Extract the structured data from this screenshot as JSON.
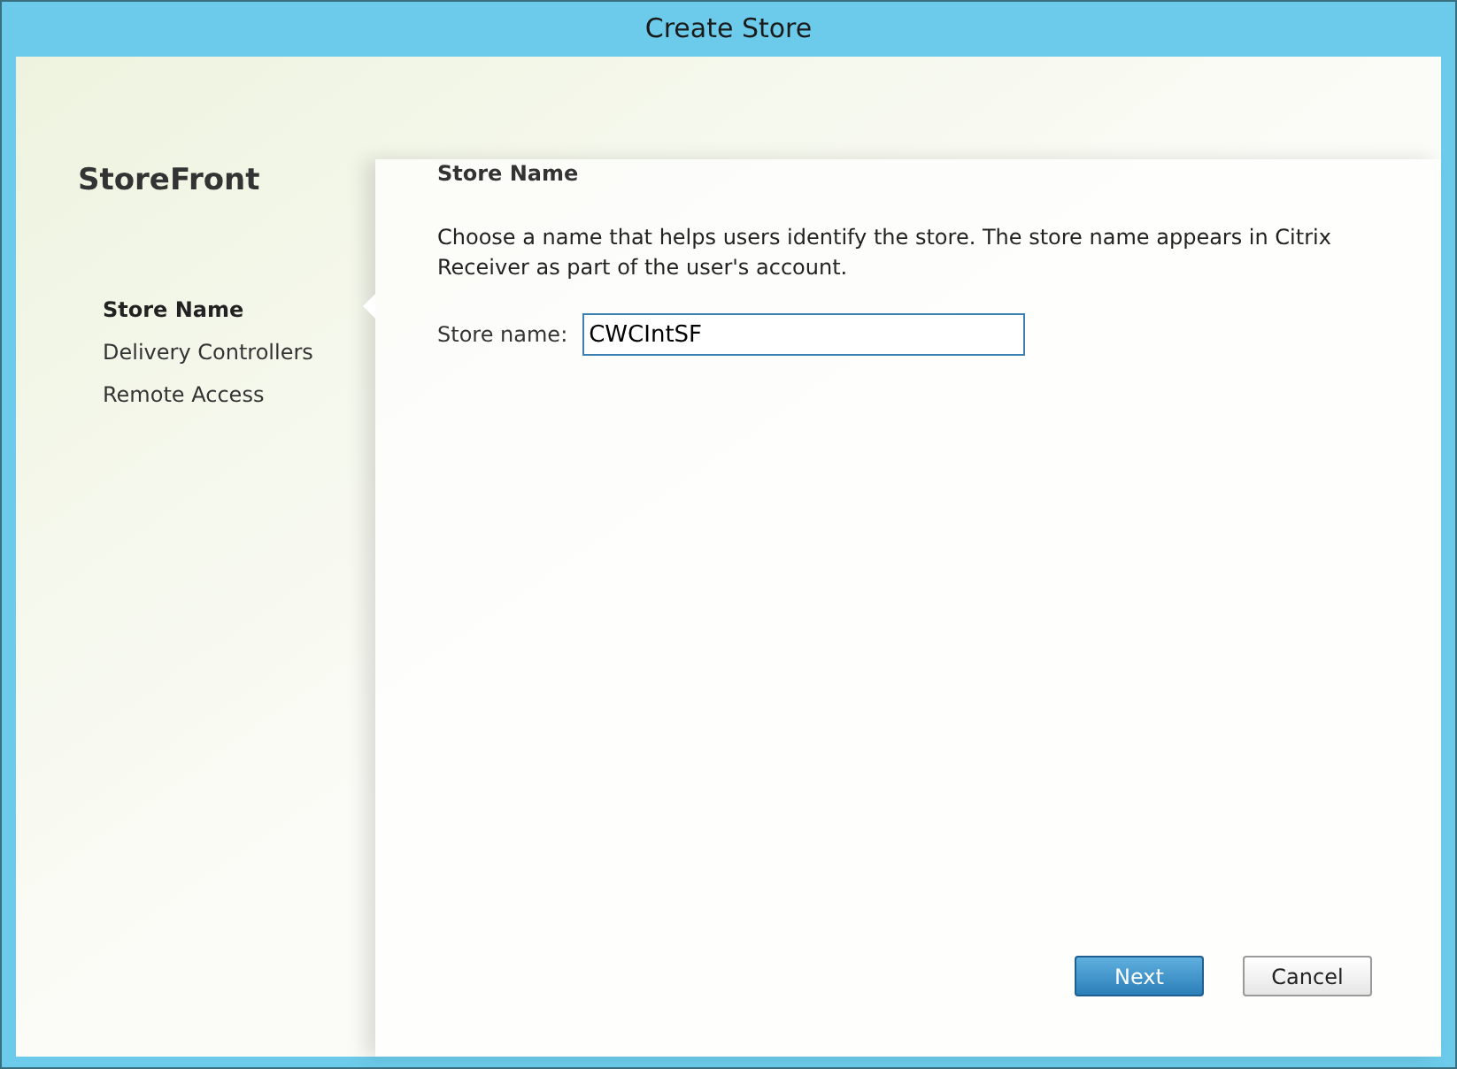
{
  "window": {
    "title": "Create Store"
  },
  "sidebar": {
    "product": "StoreFront",
    "steps": [
      {
        "label": "Store Name",
        "selected": true
      },
      {
        "label": "Delivery Controllers",
        "selected": false
      },
      {
        "label": "Remote Access",
        "selected": false
      }
    ]
  },
  "page": {
    "heading": "Store Name",
    "description": "Choose a name that helps users identify the store. The store name appears in Citrix Receiver as part of the user's account.",
    "field": {
      "label": "Store name:",
      "value": "CWCIntSF"
    }
  },
  "buttons": [
    {
      "label": "Next",
      "kind": "primary"
    },
    {
      "label": "Cancel",
      "kind": "secondary"
    }
  ]
}
